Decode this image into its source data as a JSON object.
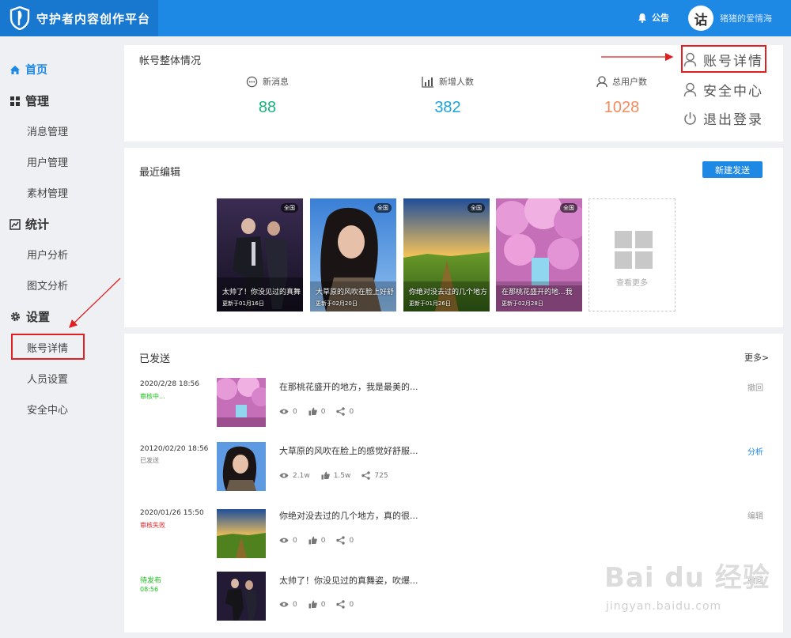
{
  "header": {
    "logo_text": "守护者内容创作平台",
    "notice_label": "公告",
    "avatar_char": "诂",
    "username": "猪猪的爱情海"
  },
  "sidebar": {
    "home": "首页",
    "groups": [
      {
        "label": "管理",
        "icon": "grid-icon",
        "items": [
          "消息管理",
          "用户管理",
          "素材管理"
        ]
      },
      {
        "label": "统计",
        "icon": "chart-icon",
        "items": [
          "用户分析",
          "图文分析"
        ]
      },
      {
        "label": "设置",
        "icon": "gear-icon",
        "items": [
          "账号详情",
          "人员设置",
          "安全中心"
        ]
      }
    ],
    "highlighted_item": "账号详情"
  },
  "overview": {
    "title": "帐号整体情况",
    "stats": [
      {
        "label": "新消息",
        "value": "88",
        "icon": "message-icon",
        "color": "#19b27b"
      },
      {
        "label": "新增人数",
        "value": "382",
        "icon": "bar-chart-icon",
        "color": "#1aa3d9"
      },
      {
        "label": "总用户数",
        "value": "1028",
        "icon": "user-icon",
        "color": "#f58a5c"
      }
    ]
  },
  "account_menu": {
    "items": [
      {
        "label": "账号详情",
        "icon": "user-icon"
      },
      {
        "label": "安全中心",
        "icon": "user-icon"
      },
      {
        "label": "退出登录",
        "icon": "power-icon"
      }
    ]
  },
  "recent": {
    "title": "最近编辑",
    "new_button": "新建发送",
    "cards": [
      {
        "badge": "全国",
        "title": "太帅了！你没见过的真舞",
        "date": "更新于01月16日"
      },
      {
        "badge": "全国",
        "title": "大草原的风吹在脸上好舒",
        "date": "更新于02月20日"
      },
      {
        "badge": "全国",
        "title": "你绝对没去过的几个地方",
        "date": "更新于01月26日"
      },
      {
        "badge": "全国",
        "title": "在那桃花盛开的地...我",
        "date": "更新于02月28日"
      }
    ],
    "more_label": "查看更多"
  },
  "sent": {
    "title": "已发送",
    "more_link": "更多>",
    "rows": [
      {
        "time": "2020/2/28 18:56",
        "status": "审核中...",
        "status_color": "#19c219",
        "title": "在那桃花盛开的地方，我是最美的...",
        "views": "0",
        "likes": "0",
        "shares": "0",
        "action": "撤回",
        "action_blue": false
      },
      {
        "time": "20120/02/20 18:56",
        "status": "已发送",
        "status_color": "#777777",
        "title": "大草原的风吹在脸上的感觉好舒服...",
        "views": "2.1w",
        "likes": "1.5w",
        "shares": "725",
        "action": "分析",
        "action_blue": true
      },
      {
        "time": "2020/01/26 15:50",
        "status": "审核失败",
        "status_color": "#e02020",
        "title": "你绝对没去过的几个地方，真的很...",
        "views": "0",
        "likes": "0",
        "shares": "0",
        "action": "编辑",
        "action_blue": false
      },
      {
        "time": "待发布",
        "status": "08:56",
        "status_color": "#19c219",
        "title": "太帅了！你没见过的真舞姿，吹爆...",
        "views": "0",
        "likes": "0",
        "shares": "0",
        "action": "撤回",
        "action_blue": false
      }
    ]
  },
  "watermark": {
    "main": "Bai du 经验",
    "sub": "jingyan.baidu.com"
  }
}
